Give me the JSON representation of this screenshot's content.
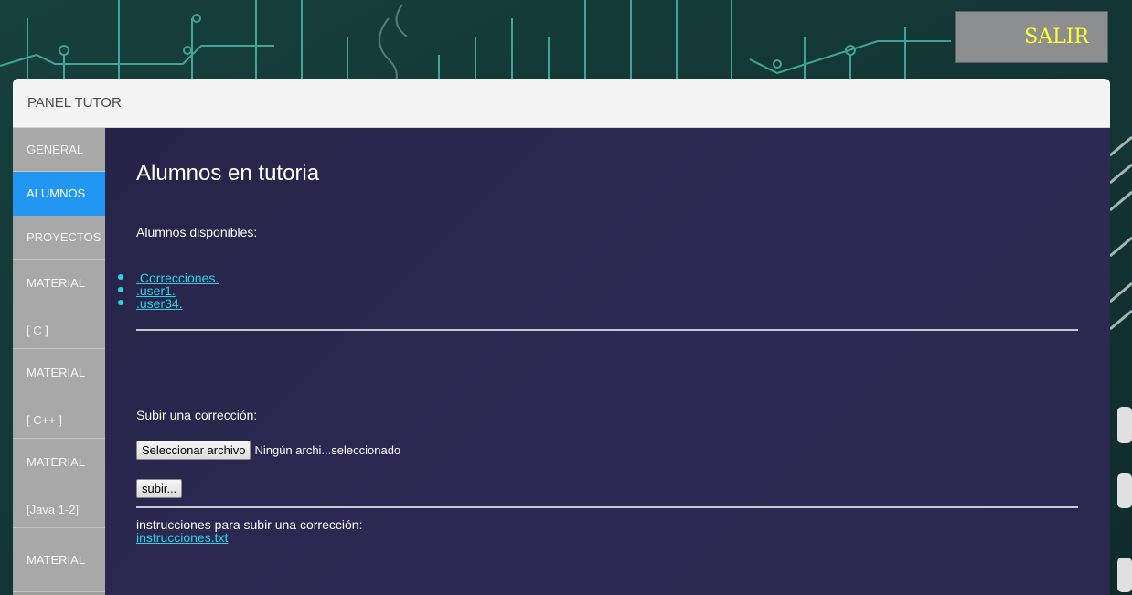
{
  "header": {
    "logout_label": "SALIR",
    "panel_title": "PANEL TUTOR"
  },
  "sidebar": {
    "tabs": [
      {
        "line1": "GENERAL",
        "line2": "",
        "active": false
      },
      {
        "line1": "ALUMNOS",
        "line2": "",
        "active": true
      },
      {
        "line1": "PROYECTOS",
        "line2": "",
        "active": false
      },
      {
        "line1": "MATERIAL",
        "line2": "[ C ]",
        "active": false
      },
      {
        "line1": "MATERIAL",
        "line2": "[ C++ ]",
        "active": false
      },
      {
        "line1": "MATERIAL",
        "line2": "[Java 1-2]",
        "active": false
      },
      {
        "line1": "MATERIAL",
        "line2": "",
        "active": false
      }
    ]
  },
  "main": {
    "title": "Alumnos en tutoria",
    "available_label": "Alumnos disponibles:",
    "students": [
      ".Correcciones.",
      ".user1.",
      ".user34."
    ],
    "upload": {
      "label": "Subir una corrección:",
      "choose_button": "Seleccionar archivo",
      "file_status": "Ningún archi...seleccionado",
      "submit_button": "subir..."
    },
    "instructions": {
      "text": "instrucciones para subir una corrección:",
      "link": "instrucciones.txt"
    }
  },
  "colors": {
    "accent": "#2196f3",
    "link": "#29d3e8",
    "logout_text": "#ffff33"
  }
}
